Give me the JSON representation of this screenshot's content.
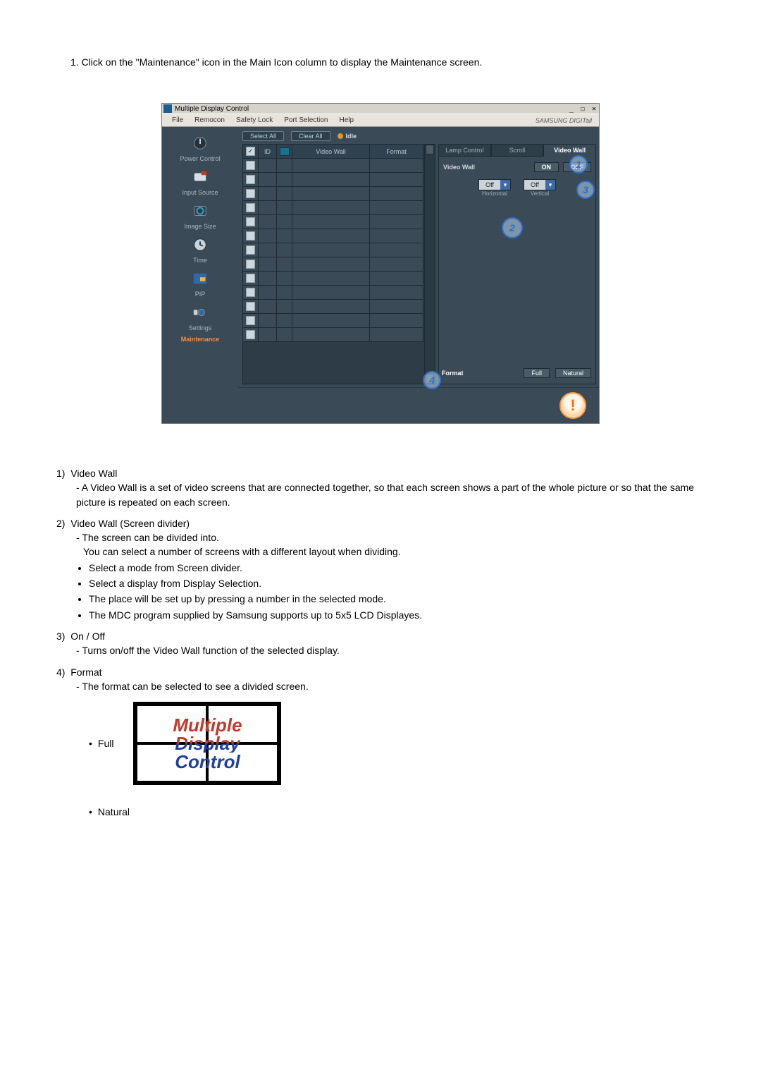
{
  "intro_step": "1.  Click on the \"Maintenance\" icon in the Main Icon column to display the Maintenance screen.",
  "app": {
    "window_title": "Multiple Display Control",
    "win_controls": "_ ☐ ✕",
    "menus": [
      "File",
      "Remocon",
      "Safety Lock",
      "Port Selection",
      "Help"
    ],
    "brand": "SAMSUNG DIGITall"
  },
  "sidebar": [
    {
      "label": "Power Control"
    },
    {
      "label": "Input Source"
    },
    {
      "label": "Image Size"
    },
    {
      "label": "Time"
    },
    {
      "label": "PIP"
    },
    {
      "label": "Settings"
    },
    {
      "label": "Maintenance"
    }
  ],
  "toolbar": {
    "select_all": "Select All",
    "clear_all": "Clear All",
    "idle": "Idle"
  },
  "grid": {
    "header_id": "ID",
    "header_vw": "Video Wall",
    "header_fmt": "Format"
  },
  "right": {
    "tabs": [
      "Lamp Control",
      "Scroll",
      "Video Wall"
    ],
    "video_wall_label": "Video Wall",
    "on": "ON",
    "off": "OFF",
    "dd1_value": "Off",
    "dd2_value": "Off",
    "dd1_sub": "Horizontal",
    "dd2_sub": "Vertical",
    "format_label": "Format",
    "format_full": "Full",
    "format_nat": "Natural"
  },
  "callouts": {
    "c1": "1",
    "c2": "2",
    "c3": "3",
    "c4": "4"
  },
  "explain": {
    "items": [
      {
        "num": "1)",
        "title": "Video Wall",
        "dashes": [
          "A Video Wall is a set of video screens that are connected together, so that each screen shows a part of the whole picture or so that the same picture is repeated on each screen."
        ]
      },
      {
        "num": "2)",
        "title": "Video Wall (Screen divider)",
        "dashes": [
          "The screen can be divided into."
        ],
        "followup": "You can select a number of screens with a different layout when dividing.",
        "bullets": [
          "Select a mode from Screen divider.",
          "Select a display from Display Selection.",
          "The place will be set up by pressing a number in the selected mode.",
          "The MDC program supplied by Samsung supports up to 5x5 LCD Displayes."
        ]
      },
      {
        "num": "3)",
        "title": "On / Off",
        "dashes": [
          "Turns on/off the Video Wall function of the selected display."
        ]
      },
      {
        "num": "4)",
        "title": "Format",
        "dashes": [
          "The format can be selected to see a divided screen."
        ]
      }
    ],
    "full_label": "Full",
    "natural_label": "Natural",
    "mdc_words": [
      "Multiple",
      "Display",
      "Control"
    ]
  }
}
